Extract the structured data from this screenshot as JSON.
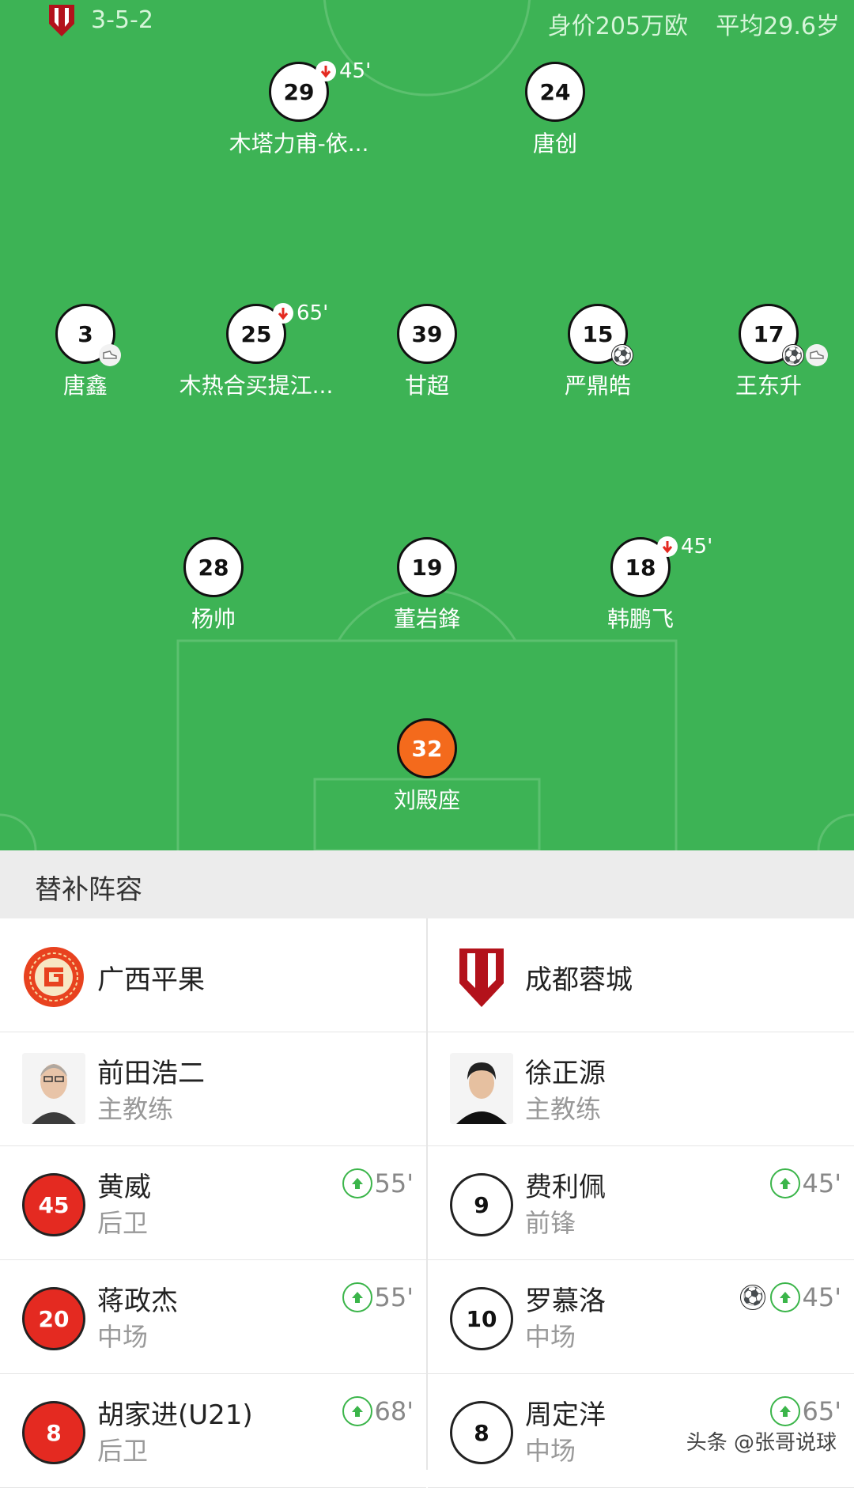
{
  "header": {
    "formation": "3-5-2",
    "value": "身价205万欧",
    "avg_age": "平均29.6岁"
  },
  "players": [
    {
      "num": "29",
      "name": "木塔力甫-依...",
      "sub_out": "45'",
      "events": []
    },
    {
      "num": "24",
      "name": "唐创",
      "sub_out": "",
      "events": []
    },
    {
      "num": "3",
      "name": "唐鑫",
      "sub_out": "",
      "events": [
        "boot"
      ]
    },
    {
      "num": "25",
      "name": "木热合买提江...",
      "sub_out": "65'",
      "events": []
    },
    {
      "num": "39",
      "name": "甘超",
      "sub_out": "",
      "events": []
    },
    {
      "num": "15",
      "name": "严鼎皓",
      "sub_out": "",
      "events": [
        "ball"
      ]
    },
    {
      "num": "17",
      "name": "王东升",
      "sub_out": "",
      "events": [
        "ball",
        "boot"
      ]
    },
    {
      "num": "28",
      "name": "杨帅",
      "sub_out": "",
      "events": []
    },
    {
      "num": "19",
      "name": "董岩鋒",
      "sub_out": "",
      "events": []
    },
    {
      "num": "18",
      "name": "韩鹏飞",
      "sub_out": "45'",
      "events": []
    },
    {
      "num": "32",
      "name": "刘殿座",
      "sub_out": "",
      "events": []
    }
  ],
  "subs": {
    "title": "替补阵容",
    "left": {
      "team": "广西平果",
      "coach": {
        "name": "前田浩二",
        "role": "主教练"
      },
      "players": [
        {
          "num": "45",
          "name": "黄威",
          "pos": "后卫",
          "sub_in": "55'"
        },
        {
          "num": "20",
          "name": "蒋政杰",
          "pos": "中场",
          "sub_in": "55'"
        },
        {
          "num": "8",
          "name": "胡家进(U21)",
          "pos": "后卫",
          "sub_in": "68'"
        }
      ]
    },
    "right": {
      "team": "成都蓉城",
      "coach": {
        "name": "徐正源",
        "role": "主教练"
      },
      "players": [
        {
          "num": "9",
          "name": "费利佩",
          "pos": "前锋",
          "sub_in": "45'"
        },
        {
          "num": "10",
          "name": "罗慕洛",
          "pos": "中场",
          "sub_in": "45'"
        },
        {
          "num": "8",
          "name": "周定洋",
          "pos": "中场",
          "sub_in": "65'"
        }
      ]
    }
  },
  "watermark": "头条 @张哥说球",
  "colors": {
    "pitch": "#3db355",
    "gk": "#f46a1c",
    "home_sub": "#e42a21"
  }
}
